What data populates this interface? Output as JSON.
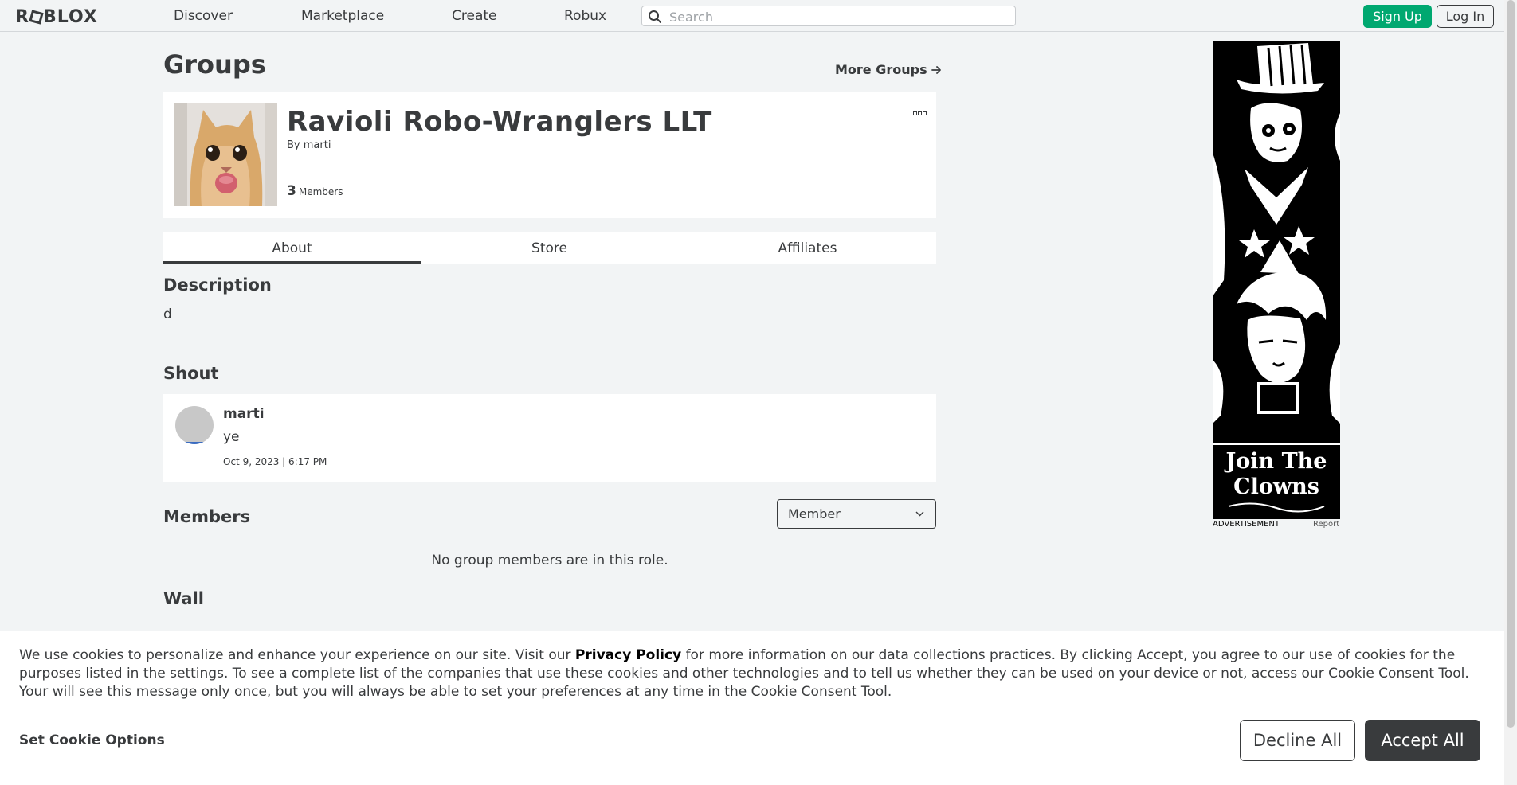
{
  "nav": {
    "logo": "ROBLOX",
    "links": [
      "Discover",
      "Marketplace",
      "Create",
      "Robux"
    ],
    "search_placeholder": "Search",
    "signup": "Sign Up",
    "login": "Log In"
  },
  "page": {
    "title": "Groups",
    "more_groups": "More Groups"
  },
  "group": {
    "name": "Ravioli Robo-Wranglers LLT",
    "by_label": "By",
    "owner": "marti",
    "member_count": "3",
    "members_label": "Members"
  },
  "tabs": [
    "About",
    "Store",
    "Affiliates"
  ],
  "active_tab": "About",
  "about": {
    "description_heading": "Description",
    "description": "d",
    "shout_heading": "Shout",
    "shout": {
      "user": "marti",
      "body": "ye",
      "date": "Oct 9, 2023 | 6:17 PM"
    },
    "members_heading": "Members",
    "role_selected": "Member",
    "no_members": "No group members are in this role.",
    "wall_heading": "Wall"
  },
  "ad": {
    "image_text_line1": "Join The",
    "image_text_line2": "Clowns",
    "label": "ADVERTISEMENT",
    "report": "Report"
  },
  "cookie": {
    "text_before": "We use cookies to personalize and enhance your experience on our site. Visit our ",
    "privacy_link": "Privacy Policy",
    "text_after": " for more information on our data collections practices. By clicking Accept, you agree to our use of cookies for the purposes listed in the settings. To see a complete list of the companies that use these cookies and other technologies and to tell us whether they can be used on your device or not, access our Cookie Consent Tool. Your will see this message only once, but you will always be able to set your preferences at any time in the Cookie Consent Tool.",
    "options": "Set Cookie Options",
    "decline": "Decline All",
    "accept": "Accept All"
  },
  "colors": {
    "background": "#f2f4f5",
    "text": "#393b3d",
    "signup_green": "#00a870",
    "accept_dark": "#393b3d"
  }
}
